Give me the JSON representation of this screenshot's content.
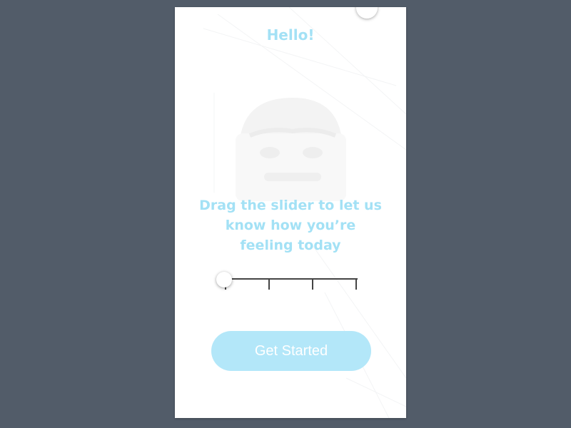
{
  "screen": {
    "greeting": "Hello!",
    "prompt_lines": [
      "Drag the slider to let us",
      "know how you’re",
      "feeling today"
    ],
    "get_started_label": "Get Started"
  },
  "mood_slider": {
    "steps": 5,
    "selected_step": 1
  },
  "colors": {
    "backdrop": "#525c69",
    "screen": "#ffffff",
    "accent_text": "#a3e1f5",
    "button_fill": "#b3e7f9",
    "button_text": "#ffffff",
    "slider_track": "#444444"
  },
  "icons": {
    "face_illustration": "face-icon"
  }
}
